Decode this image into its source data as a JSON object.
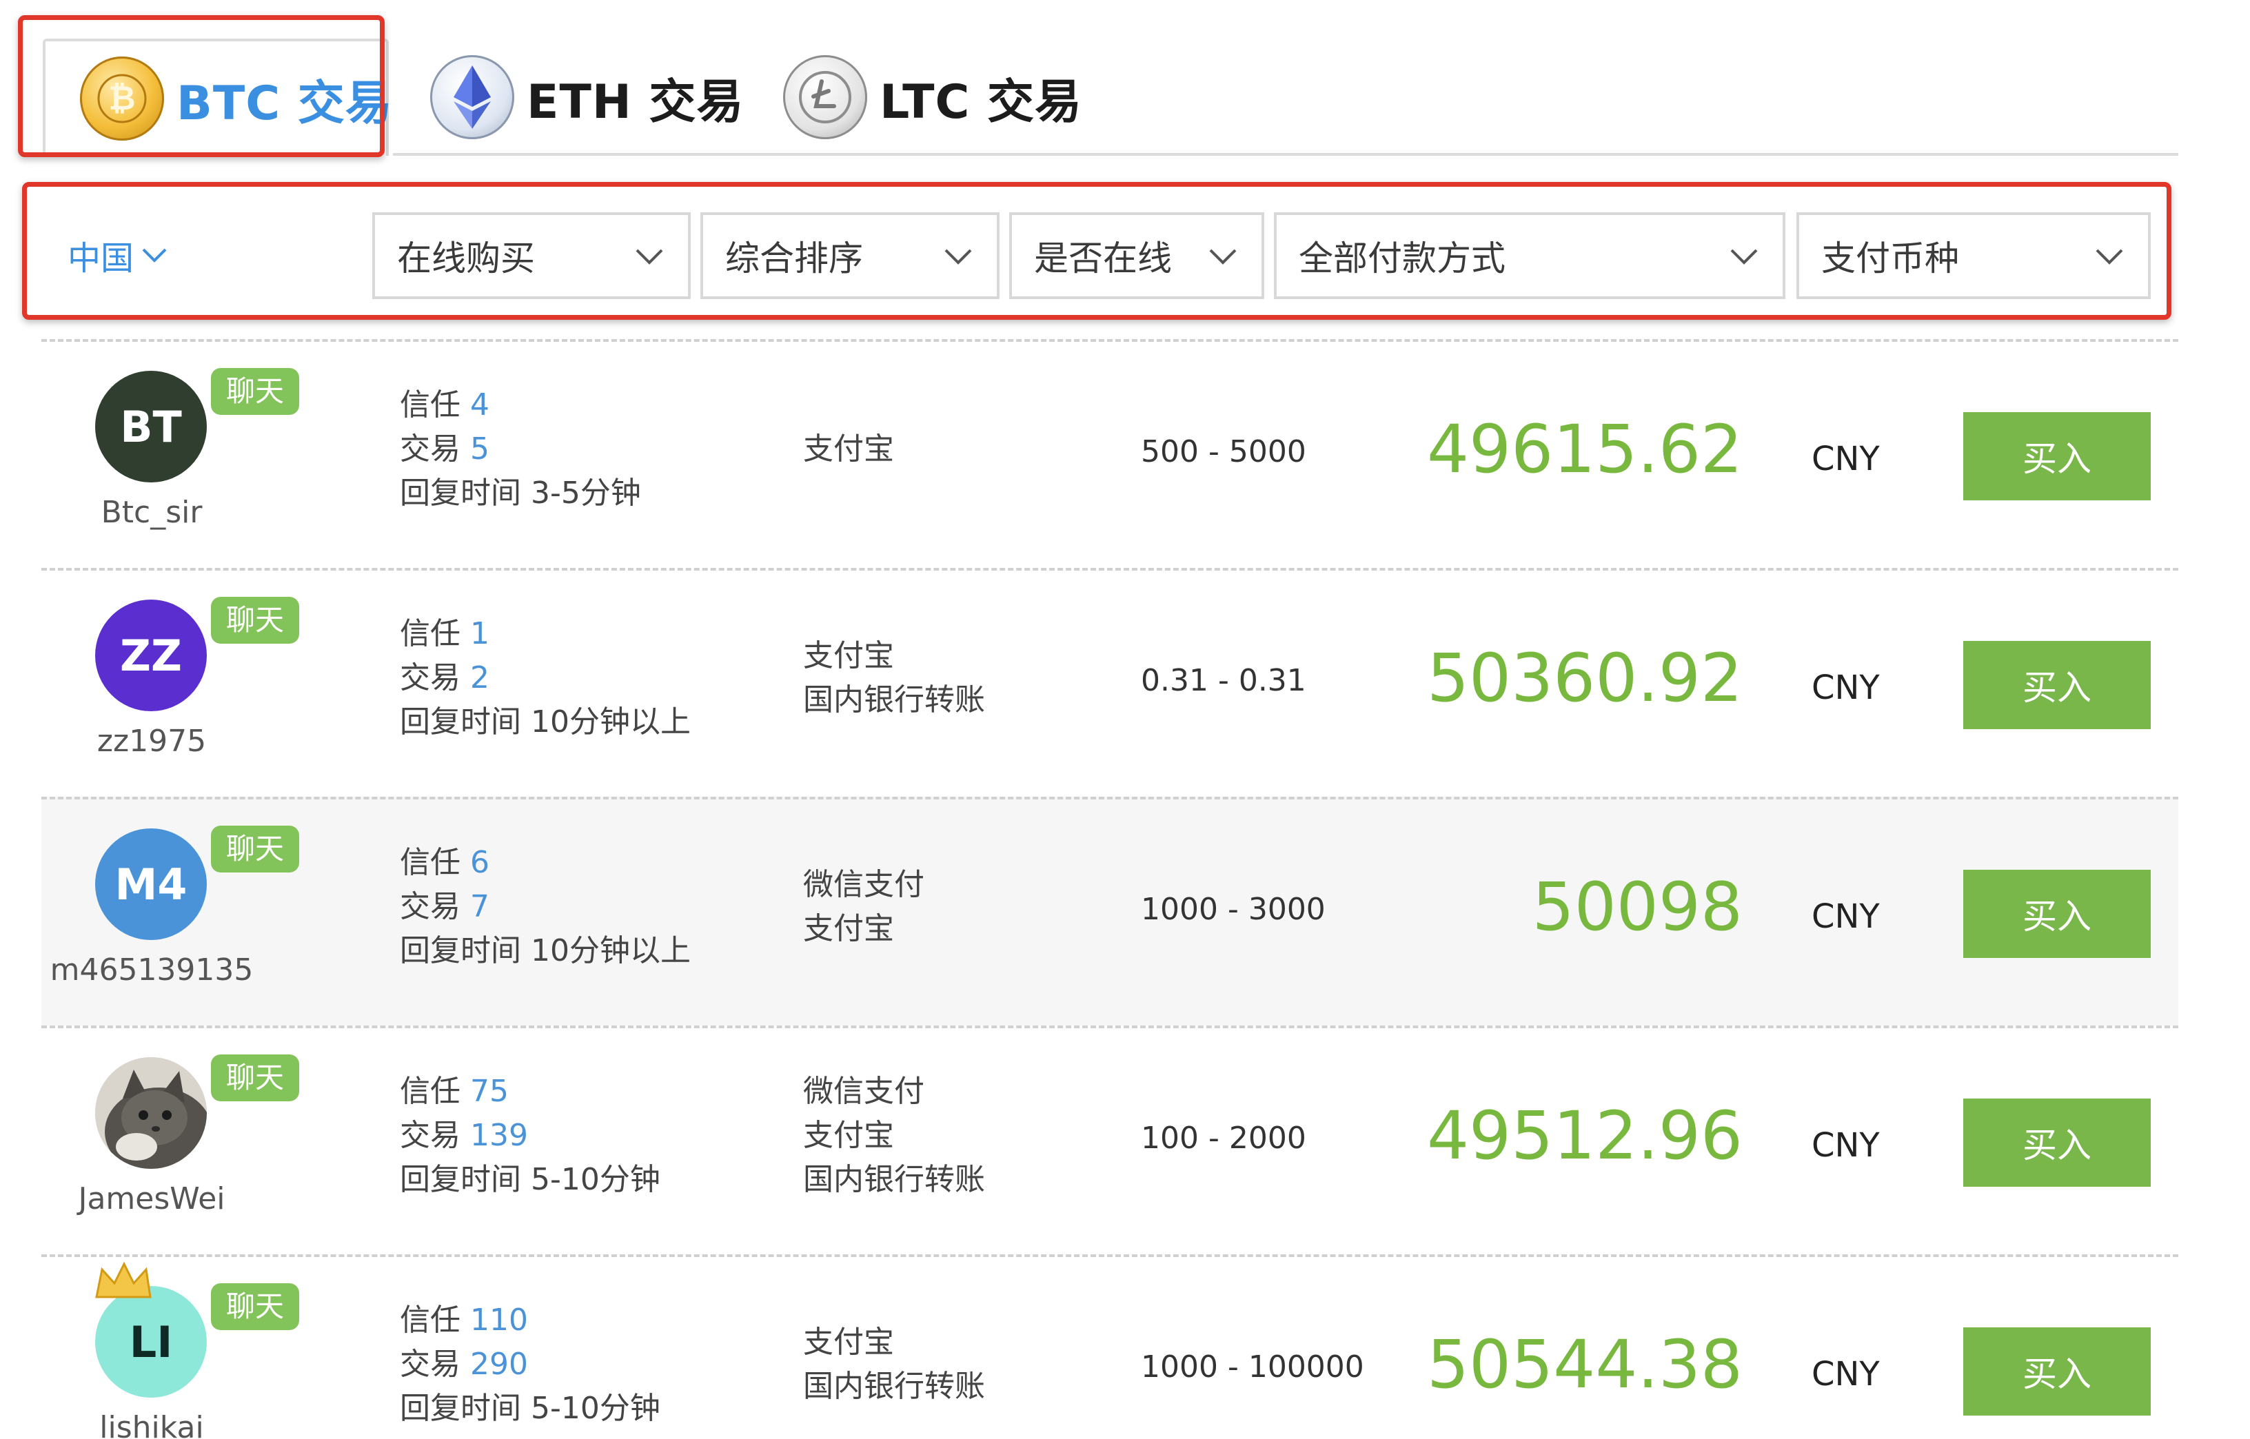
{
  "tabs": [
    {
      "label": "BTC 交易",
      "coin": "btc",
      "active": true
    },
    {
      "label": "ETH 交易",
      "coin": "eth",
      "active": false
    },
    {
      "label": "LTC 交易",
      "coin": "ltc",
      "active": false
    }
  ],
  "filters": {
    "region": "中国",
    "selects": [
      "在线购买",
      "综合排序",
      "是否在线",
      "全部付款方式",
      "支付币种"
    ]
  },
  "listing": {
    "chat_label": "聊天",
    "trust_label": "信任",
    "trade_label": "交易",
    "reply_label": "回复时间",
    "currency": "CNY",
    "buy_label": "买入",
    "rows": [
      {
        "initials": "BT",
        "avatar_color": "#2f3e2f",
        "username": "Btc_sir",
        "trust": "4",
        "trades": "5",
        "reply": "3-5分钟",
        "methods": [
          "支付宝"
        ],
        "range": "500 - 5000",
        "price": "49615.62"
      },
      {
        "initials": "ZZ",
        "avatar_color": "#5b2fcf",
        "username": "zz1975",
        "trust": "1",
        "trades": "2",
        "reply": "10分钟以上",
        "methods": [
          "支付宝",
          "国内银行转账"
        ],
        "range": "0.31 - 0.31",
        "price": "50360.92"
      },
      {
        "initials": "M4",
        "avatar_color": "#4a93d9",
        "username": "m465139135",
        "trust": "6",
        "trades": "7",
        "reply": "10分钟以上",
        "methods": [
          "微信支付",
          "支付宝"
        ],
        "range": "1000 - 3000",
        "price": "50098"
      },
      {
        "initials": "",
        "avatar_color": "#6c6a66",
        "username": "JamesWei",
        "trust": "75",
        "trades": "139",
        "reply": "5-10分钟",
        "methods": [
          "微信支付",
          "支付宝",
          "国内银行转账"
        ],
        "range": "100 - 2000",
        "price": "49512.96"
      },
      {
        "initials": "LI",
        "avatar_color": "#8ee8da",
        "username": "lishikai",
        "trust": "110",
        "trades": "290",
        "reply": "5-10分钟",
        "methods": [
          "支付宝",
          "国内银行转账"
        ],
        "range": "1000 - 100000",
        "price": "50544.38"
      }
    ]
  },
  "colors": {
    "accent_blue": "#3b8fe0",
    "price_green": "#78b83e",
    "button_green": "#79b74a",
    "highlight_red": "#e0372a"
  }
}
